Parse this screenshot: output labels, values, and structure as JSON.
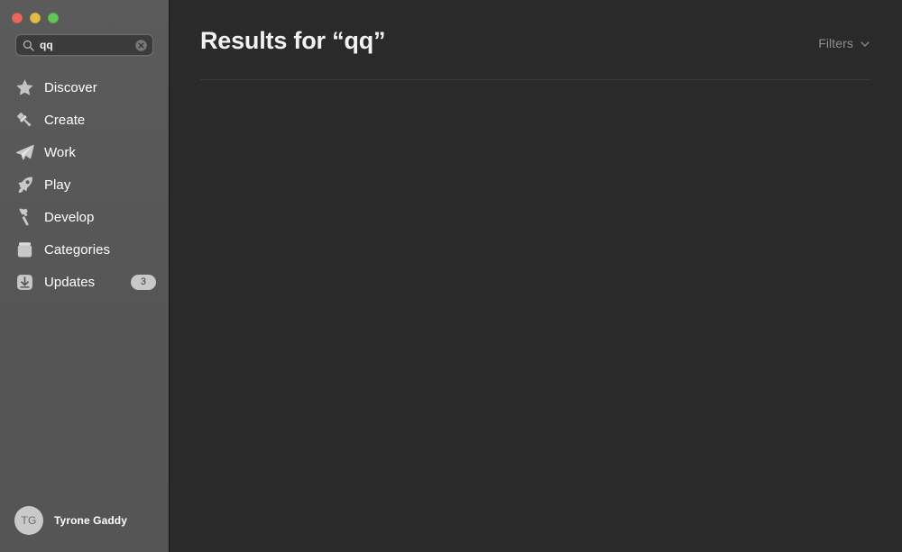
{
  "window": {
    "traffic_lights": [
      {
        "name": "close",
        "color": "#e9685e"
      },
      {
        "name": "minimize",
        "color": "#e3bc48"
      },
      {
        "name": "maximize",
        "color": "#63c556"
      }
    ]
  },
  "search": {
    "value": "qq",
    "placeholder": "Search",
    "search_icon": "search-icon",
    "clear_icon": "clear-icon"
  },
  "sidebar": {
    "items": [
      {
        "label": "Discover",
        "icon": "star-icon"
      },
      {
        "label": "Create",
        "icon": "paintbrush-icon"
      },
      {
        "label": "Work",
        "icon": "paper-plane-icon"
      },
      {
        "label": "Play",
        "icon": "rocket-icon"
      },
      {
        "label": "Develop",
        "icon": "hammer-icon"
      },
      {
        "label": "Categories",
        "icon": "box-icon"
      },
      {
        "label": "Updates",
        "icon": "download-icon",
        "badge": "3"
      }
    ],
    "account": {
      "initials": "TG",
      "name": "Tyrone Gaddy"
    }
  },
  "content": {
    "title": "Results for “qq”",
    "filters": {
      "label": "Filters",
      "chevron_icon": "chevron-down-icon"
    }
  },
  "colors": {
    "sidebar_bg": "#585858",
    "content_bg": "#2a2a2a",
    "badge_bg": "#c8c8c8",
    "title_text": "#f2f2f2",
    "muted_text": "#8e8e8e"
  }
}
